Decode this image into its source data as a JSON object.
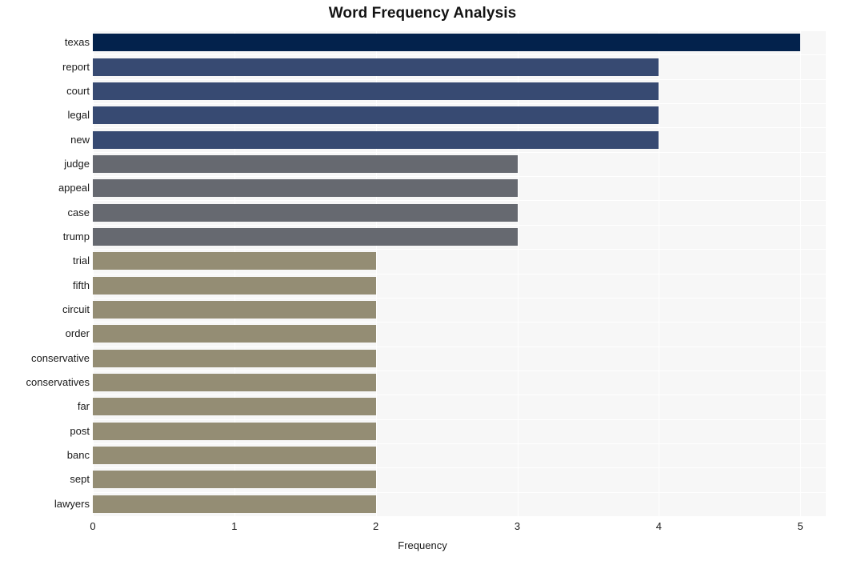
{
  "chart_data": {
    "type": "bar",
    "orientation": "horizontal",
    "title": "Word Frequency Analysis",
    "xlabel": "Frequency",
    "ylabel": "",
    "xlim": [
      0,
      5.18
    ],
    "xticks": [
      0,
      1,
      2,
      3,
      4,
      5
    ],
    "xticklabels": [
      "0",
      "1",
      "2",
      "3",
      "4",
      "5"
    ],
    "grid": true,
    "legend": "none",
    "categories": [
      "texas",
      "report",
      "court",
      "legal",
      "new",
      "judge",
      "appeal",
      "case",
      "trump",
      "trial",
      "fifth",
      "circuit",
      "order",
      "conservative",
      "conservatives",
      "far",
      "post",
      "banc",
      "sept",
      "lawyers"
    ],
    "values": [
      5,
      4,
      4,
      4,
      4,
      3,
      3,
      3,
      3,
      2,
      2,
      2,
      2,
      2,
      2,
      2,
      2,
      2,
      2,
      2
    ],
    "bar_colors": [
      "#03224c",
      "#374a72",
      "#374a72",
      "#374a72",
      "#374a72",
      "#666970",
      "#666970",
      "#666970",
      "#666970",
      "#948d74",
      "#948d74",
      "#948d74",
      "#948d74",
      "#948d74",
      "#948d74",
      "#948d74",
      "#948d74",
      "#948d74",
      "#948d74",
      "#948d74"
    ]
  },
  "style": {
    "plot_background": "#f7f7f7",
    "grid_color": "#ffffff",
    "page_background": "#ffffff",
    "text_color": "#1a1a1a",
    "title_color": "#141414"
  }
}
